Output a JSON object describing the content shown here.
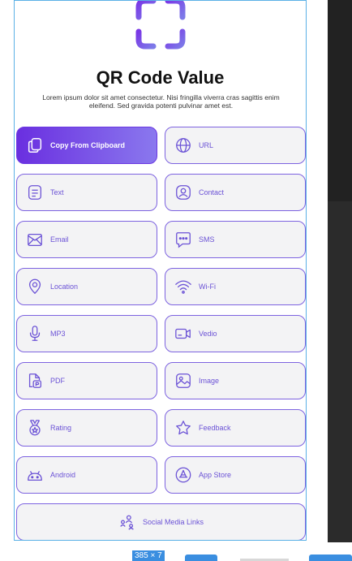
{
  "header": {
    "title": "QR Code Value",
    "description": "Lorem ipsum dolor sit amet consectetur. Nisi fringilla viverra cras sagittis enim eleifend. Sed gravida potenti pulvinar amet est."
  },
  "options": [
    {
      "label": "Copy From Clipboard",
      "icon": "clipboard-icon"
    },
    {
      "label": "URL",
      "icon": "globe-icon"
    },
    {
      "label": "Text",
      "icon": "text-document-icon"
    },
    {
      "label": "Contact",
      "icon": "contact-icon"
    },
    {
      "label": "Email",
      "icon": "email-icon"
    },
    {
      "label": "SMS",
      "icon": "sms-icon"
    },
    {
      "label": "Location",
      "icon": "location-pin-icon"
    },
    {
      "label": "Wi-Fi",
      "icon": "wifi-icon"
    },
    {
      "label": "MP3",
      "icon": "microphone-icon"
    },
    {
      "label": "Vedio",
      "icon": "video-icon"
    },
    {
      "label": "PDF",
      "icon": "pdf-icon"
    },
    {
      "label": "Image",
      "icon": "image-icon"
    },
    {
      "label": "Rating",
      "icon": "rating-medal-icon"
    },
    {
      "label": "Feedback",
      "icon": "star-icon"
    },
    {
      "label": "Android",
      "icon": "android-icon"
    },
    {
      "label": "App Store",
      "icon": "app-store-icon"
    },
    {
      "label": "Social Media Links",
      "icon": "social-people-icon"
    }
  ],
  "overlay": {
    "size_label": "385 × 7"
  },
  "colors": {
    "accent": "#7d63e0",
    "primary_gradient_start": "#6a2fe0",
    "primary_gradient_end": "#8a78ee",
    "selection_border": "#5ab0e6"
  }
}
